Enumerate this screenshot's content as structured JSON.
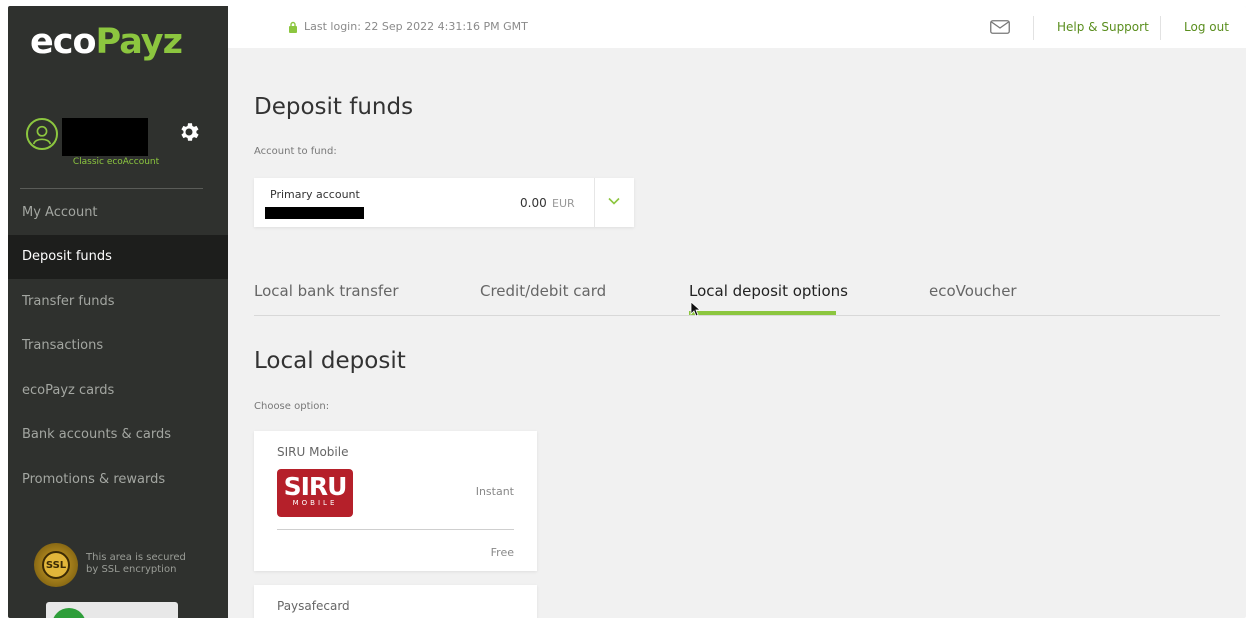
{
  "brand": {
    "eco": "eco",
    "payz": "Payz"
  },
  "user": {
    "account_type": "Classic ecoAccount"
  },
  "sidebar": {
    "items": [
      {
        "label": "My Account"
      },
      {
        "label": "Deposit funds"
      },
      {
        "label": "Transfer funds"
      },
      {
        "label": "Transactions"
      },
      {
        "label": "ecoPayz cards"
      },
      {
        "label": "Bank accounts & cards"
      },
      {
        "label": "Promotions & rewards"
      }
    ],
    "active_index": 1,
    "ssl_badge": "SSL",
    "ssl_text_line1": "This area is secured",
    "ssl_text_line2": "by SSL encryption"
  },
  "topbar": {
    "last_login": "Last login: 22 Sep 2022 4:31:16 PM GMT",
    "help": "Help & Support",
    "logout": "Log out"
  },
  "main": {
    "title": "Deposit funds",
    "account_label": "Account to fund:",
    "account": {
      "name": "Primary account",
      "balance": "0.00",
      "currency": "EUR"
    },
    "tabs": [
      {
        "label": "Local bank transfer"
      },
      {
        "label": "Credit/debit card"
      },
      {
        "label": "Local deposit options"
      },
      {
        "label": "ecoVoucher"
      }
    ],
    "active_tab_index": 2,
    "section_title": "Local deposit",
    "choose_label": "Choose option:",
    "options": [
      {
        "name": "SIRU Mobile",
        "logo_text": "SIRU",
        "logo_subtext": "MOBILE",
        "speed": "Instant",
        "fee": "Free"
      },
      {
        "name": "Paysafecard"
      }
    ]
  },
  "colors": {
    "accent": "#8cc63f",
    "sidebar_bg": "#2f312e",
    "siru_red": "#b5202a"
  },
  "icons": [
    "lock-icon",
    "mail-icon",
    "gear-icon",
    "user-icon",
    "chevron-down-icon",
    "cursor-icon"
  ]
}
